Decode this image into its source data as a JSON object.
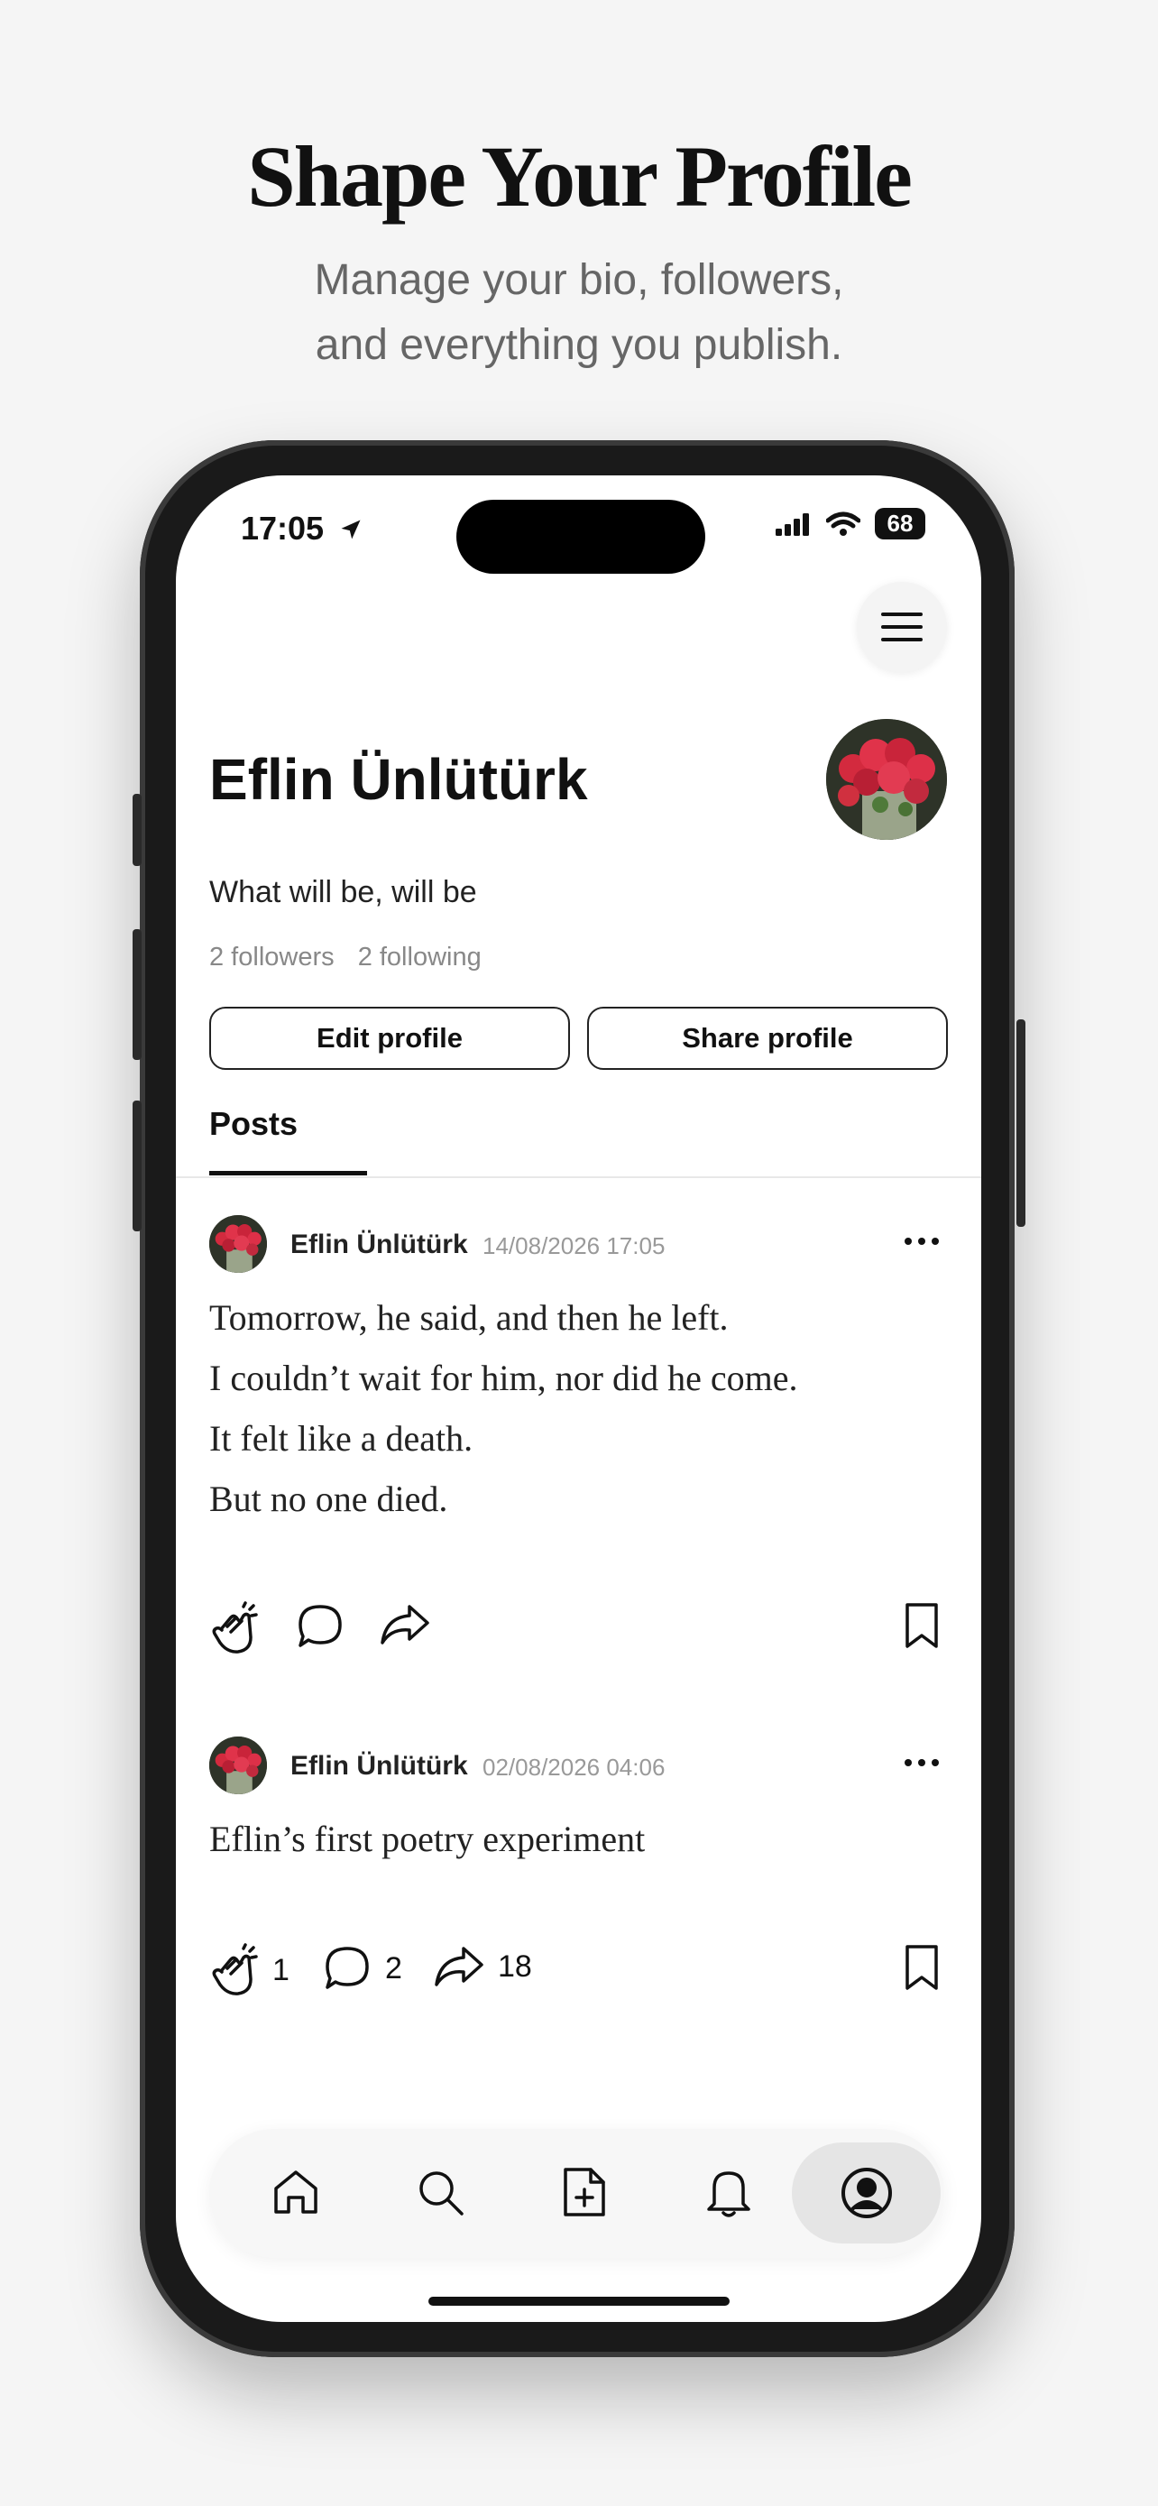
{
  "promo": {
    "headline": "Shape Your Profile",
    "subline_1": "Manage your bio, followers,",
    "subline_2": "and everything you publish."
  },
  "status_bar": {
    "time": "17:05",
    "battery": "68"
  },
  "profile": {
    "name": "Eflin Ünlütürk",
    "bio": "What will be, will be",
    "followers": "2 followers",
    "following": "2 following",
    "edit_label": "Edit profile",
    "share_label": "Share profile"
  },
  "tabs": {
    "posts": "Posts"
  },
  "posts": [
    {
      "author": "Eflin Ünlütürk",
      "time": "14/08/2026 17:05",
      "lines": [
        "Tomorrow, he said, and then he left.",
        "I couldn’t wait for him, nor did he come.",
        "It felt like a death.",
        "But no one died."
      ],
      "claps": "",
      "comments": "",
      "shares": ""
    },
    {
      "author": "Eflin Ünlütürk",
      "time": "02/08/2026 04:06",
      "lines": [
        "Eflin’s first poetry experiment"
      ],
      "claps": "1",
      "comments": "2",
      "shares": "18"
    }
  ],
  "nav": {
    "items": [
      "home-icon",
      "search-icon",
      "new-post-icon",
      "bell-icon",
      "profile-icon"
    ],
    "active": "profile-icon"
  },
  "colors": {
    "text": "#111111",
    "muted": "#888888",
    "nav_active": "#e5e5e5"
  }
}
